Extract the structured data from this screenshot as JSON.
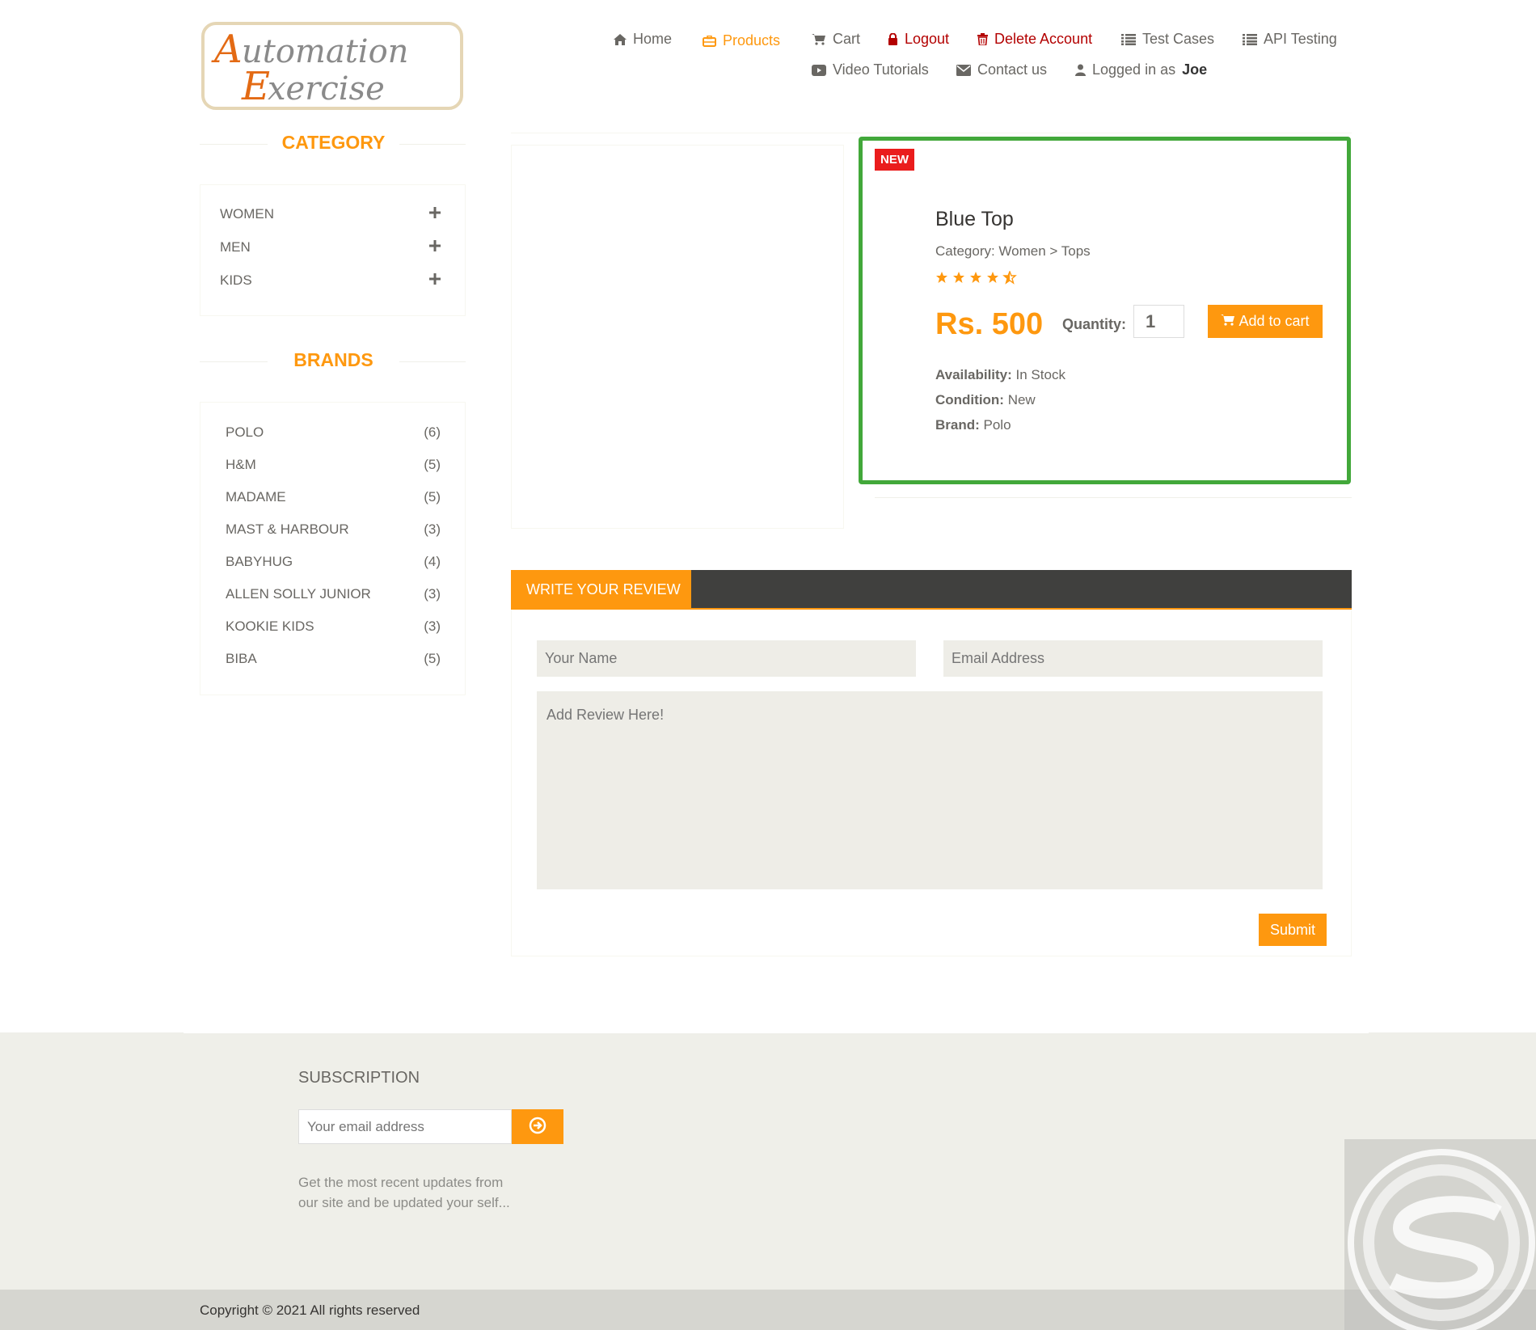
{
  "logo": {
    "line1": "Automation",
    "line2": "Exercise"
  },
  "nav": {
    "home": "Home",
    "products": "Products",
    "cart": "Cart",
    "logout": "Logout",
    "delete_account": "Delete Account",
    "test_cases": "Test Cases",
    "api_testing": "API Testing",
    "video_tutorials": "Video Tutorials",
    "contact_us": "Contact us",
    "logged_in_prefix": "Logged in as",
    "logged_in_user": "Joe"
  },
  "sidebar": {
    "category_title": "CATEGORY",
    "categories": [
      {
        "label": "WOMEN",
        "icon": "plus-icon"
      },
      {
        "label": "MEN",
        "icon": "plus-icon"
      },
      {
        "label": "KIDS",
        "icon": "plus-icon"
      }
    ],
    "brands_title": "BRANDS",
    "brands": [
      {
        "label": "POLO",
        "count": "(6)"
      },
      {
        "label": "H&M",
        "count": "(5)"
      },
      {
        "label": "MADAME",
        "count": "(5)"
      },
      {
        "label": "MAST & HARBOUR",
        "count": "(3)"
      },
      {
        "label": "BABYHUG",
        "count": "(4)"
      },
      {
        "label": "ALLEN SOLLY JUNIOR",
        "count": "(3)"
      },
      {
        "label": "KOOKIE KIDS",
        "count": "(3)"
      },
      {
        "label": "BIBA",
        "count": "(5)"
      }
    ]
  },
  "product": {
    "badge": "NEW",
    "name": "Blue Top",
    "category": "Category: Women > Tops",
    "rating": 4.5,
    "price": "Rs. 500",
    "quantity_label": "Quantity:",
    "quantity_value": "1",
    "add_to_cart": "Add to cart",
    "availability_label": "Availability:",
    "availability_value": " In Stock",
    "condition_label": "Condition:",
    "condition_value": " New",
    "brand_label": "Brand:",
    "brand_value": " Polo"
  },
  "review": {
    "tab_label": "WRITE YOUR REVIEW",
    "name_placeholder": "Your Name",
    "email_placeholder": "Email Address",
    "review_placeholder": "Add Review Here!",
    "submit_label": "Submit"
  },
  "footer": {
    "subscription_title": "SUBSCRIPTION",
    "email_placeholder": "Your email address",
    "subscription_text_1": "Get the most recent updates from",
    "subscription_text_2": "our site and be updated your self...",
    "copyright": "Copyright © 2021 All rights reserved"
  },
  "colors": {
    "accent": "#fe980f",
    "highlight": "#42a83a",
    "badge": "#ea1c1c",
    "dark": "#40403e"
  }
}
